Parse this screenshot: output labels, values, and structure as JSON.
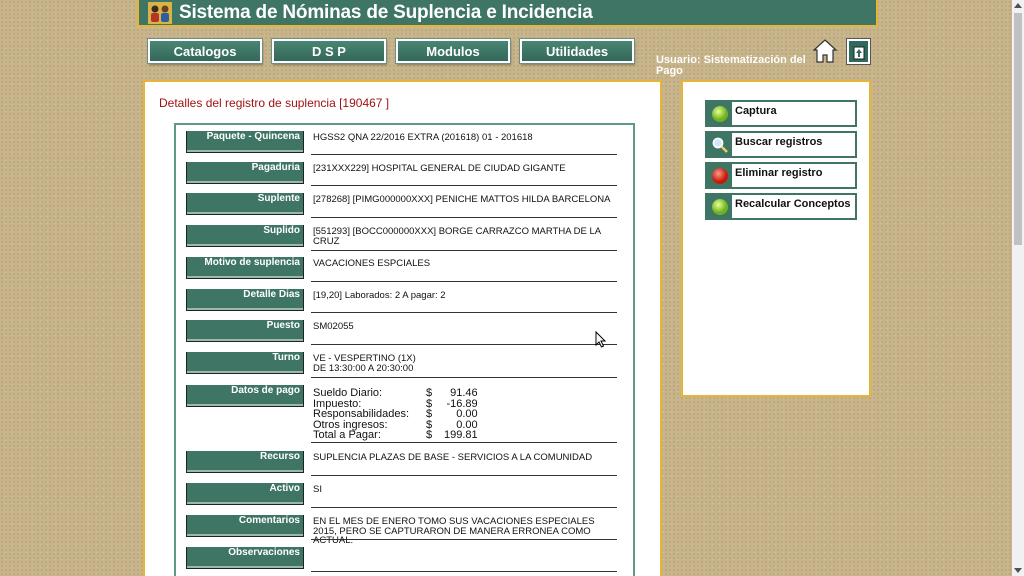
{
  "header": {
    "title": "Sistema de Nóminas de Suplencia e Incidencia"
  },
  "nav": {
    "catalogos": "Catalogos",
    "dsp": "D S P",
    "modulos": "Modulos",
    "utilidades": "Utilidades"
  },
  "user": {
    "label": "Usuario: Sistematización del Pago"
  },
  "main": {
    "title": "Detalles del registro de suplencia [190467 ]",
    "rows": [
      {
        "label": "Paquete - Quincena",
        "value": "HGSS2 QNA 22/2016 EXTRA (201618) 01 - 201618"
      },
      {
        "label": "Pagaduria",
        "value": "[231XXX229] HOSPITAL GENERAL DE CIUDAD GIGANTE"
      },
      {
        "label": "Suplente",
        "value": "[278268] [PIMG000000XXX] PENICHE MATTOS HILDA BARCELONA"
      },
      {
        "label": "Suplido",
        "value": "[551293] [BOCC000000XXX] BORGE CARRAZCO MARTHA DE LA CRUZ"
      },
      {
        "label": "Motivo de suplencia",
        "value": "VACACIONES ESPCIALES"
      },
      {
        "label": "Detalle Dias",
        "value": "[19,20] Laborados: 2 A pagar: 2"
      },
      {
        "label": "Puesto",
        "value": "SM02055"
      },
      {
        "label": "Turno",
        "value": "VE - VESPERTINO (1X)",
        "value2": "DE 13:30:00 A 20:30:00"
      },
      {
        "label": "Datos de pago"
      },
      {
        "label": "Recurso",
        "value": "SUPLENCIA PLAZAS DE BASE - SERVICIOS A LA COMUNIDAD"
      },
      {
        "label": "Activo",
        "value": "SI"
      },
      {
        "label": "Comentarios",
        "value": "EN EL MES DE ENERO TOMO SUS VACACIONES ESPECIALES 2015, PERO SE CAPTURARON DE MANERA ERRONEA COMO ACTUAL."
      },
      {
        "label": "Observaciones",
        "value": ""
      }
    ],
    "pay": [
      {
        "name": "Sueldo Diario:",
        "currency": "$",
        "amount": "91.46"
      },
      {
        "name": "Impuesto:",
        "currency": "$",
        "amount": "-16.89"
      },
      {
        "name": "Responsabilidades:",
        "currency": "$",
        "amount": "0.00"
      },
      {
        "name": "Otros ingresos:",
        "currency": "$",
        "amount": "0.00"
      },
      {
        "name": "Total a Pagar:",
        "currency": "$",
        "amount": "199.81"
      }
    ]
  },
  "side": {
    "captura": "Captura",
    "buscar": "Buscar registros",
    "eliminar": "Eliminar registro",
    "recalcular": "Recalcular Conceptos"
  },
  "colors": {
    "brand": "#3f7564",
    "accent_border": "#e6b437",
    "title_red": "#a11212"
  }
}
